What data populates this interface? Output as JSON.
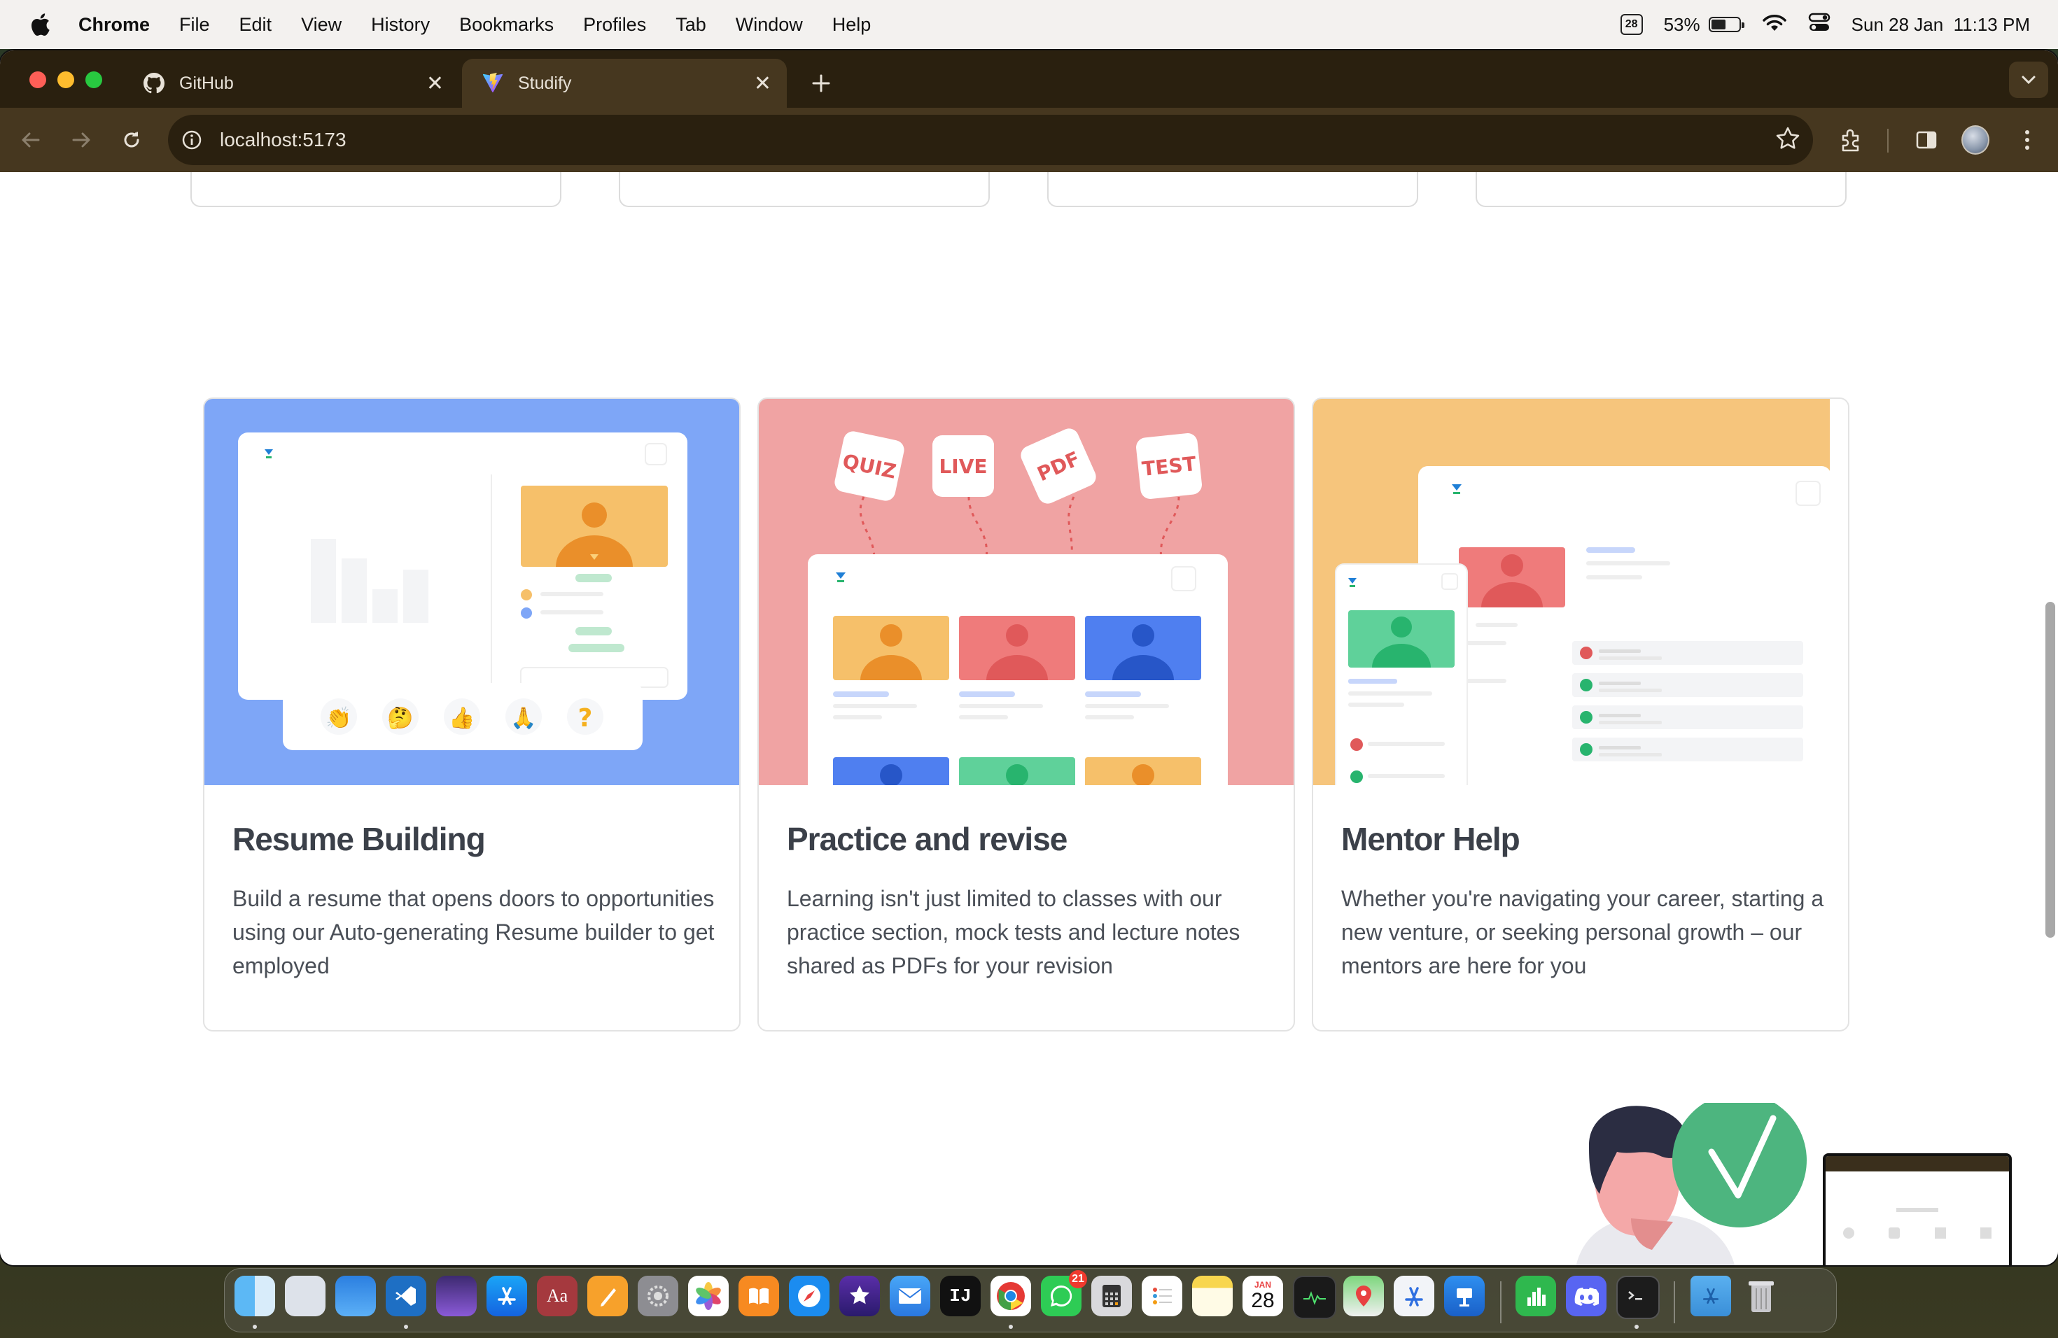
{
  "menubar": {
    "app_name": "Chrome",
    "items": [
      "File",
      "Edit",
      "View",
      "History",
      "Bookmarks",
      "Profiles",
      "Tab",
      "Window",
      "Help"
    ],
    "calendar_icon_day": "28",
    "battery_percent": "53%",
    "battery_level": 0.53,
    "datetime": "Sun 28 Jan  11:13 PM"
  },
  "browser": {
    "tabs": [
      {
        "title": "GitHub",
        "icon": "github-icon",
        "active": false
      },
      {
        "title": "Studify",
        "icon": "vite-icon",
        "active": true
      }
    ],
    "address": "localhost:5173"
  },
  "features": [
    {
      "title": "Resume Building",
      "description": "Build a resume that opens doors to opportunities using our Auto-generating Resume builder to get employed",
      "bg_color": "#7ea6f7"
    },
    {
      "title": "Practice and revise",
      "description": "Learning isn't just limited to classes with our practice section, mock tests and lecture notes shared as PDFs for your revision",
      "bg_color": "#f0a3a3",
      "badges": [
        "QUIZ",
        "LIVE",
        "PDF",
        "TEST"
      ]
    },
    {
      "title": "Mentor Help",
      "description": "Whether you're navigating your career, starting a new venture, or seeking personal growth – our mentors are here for you",
      "bg_color": "#f6c57c"
    }
  ],
  "dock": {
    "calendar_month": "JAN",
    "calendar_day": "28",
    "whatsapp_badge": "21",
    "dictionary_label": "Aa",
    "intellij_label": "IJ"
  }
}
